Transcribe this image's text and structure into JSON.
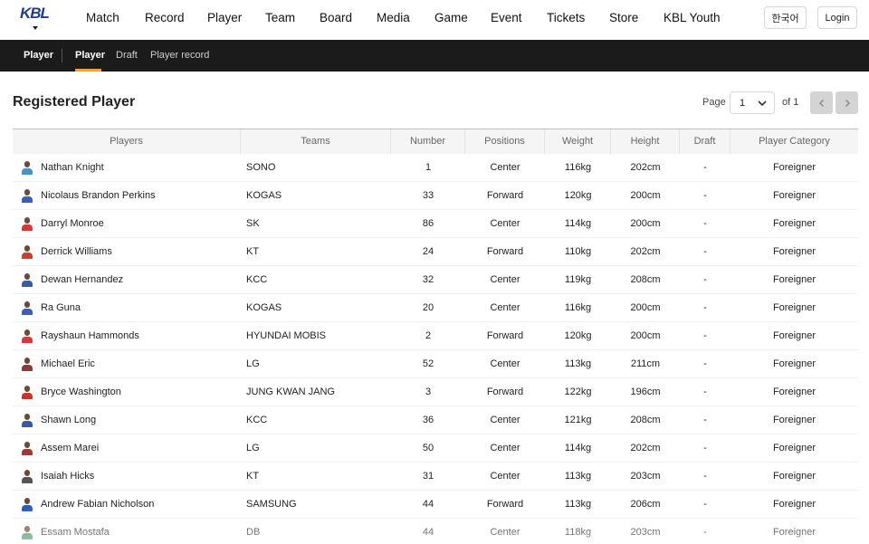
{
  "nav": {
    "logo_text": "KBL",
    "items": [
      "Match",
      "Record",
      "Player",
      "Team",
      "Board",
      "Media",
      "Game",
      "Event",
      "Tickets",
      "Store",
      "KBL Youth"
    ],
    "lang_button": "한국어",
    "login_button": "Login"
  },
  "subnav": {
    "section": "Player",
    "tabs": [
      "Player",
      "Draft",
      "Player record"
    ],
    "active_tab": "Player",
    "accent_color": "#f0a33c"
  },
  "page": {
    "title": "Registered Player",
    "page_label": "Page",
    "page_value": "1",
    "page_of": "of 1"
  },
  "table": {
    "columns": [
      "Players",
      "Teams",
      "Number",
      "Positions",
      "Weight",
      "Height",
      "Draft",
      "Player Category"
    ],
    "rows": [
      {
        "player": "Nathan Knight",
        "team": "SONO",
        "number": "1",
        "position": "Center",
        "weight": "116kg",
        "height": "202cm",
        "draft": "-",
        "category": "Foreigner",
        "jersey": "#4a90c8"
      },
      {
        "player": "Nicolaus Brandon Perkins",
        "team": "KOGAS",
        "number": "33",
        "position": "Forward",
        "weight": "120kg",
        "height": "200cm",
        "draft": "-",
        "category": "Foreigner",
        "jersey": "#3b5fb5"
      },
      {
        "player": "Darryl Monroe",
        "team": "SK",
        "number": "86",
        "position": "Center",
        "weight": "114kg",
        "height": "200cm",
        "draft": "-",
        "category": "Foreigner",
        "jersey": "#d23a3a"
      },
      {
        "player": "Derrick Williams",
        "team": "KT",
        "number": "24",
        "position": "Forward",
        "weight": "110kg",
        "height": "202cm",
        "draft": "-",
        "category": "Foreigner",
        "jersey": "#c8402f"
      },
      {
        "player": "Dewan Hernandez",
        "team": "KCC",
        "number": "32",
        "position": "Center",
        "weight": "119kg",
        "height": "208cm",
        "draft": "-",
        "category": "Foreigner",
        "jersey": "#3a5a9c"
      },
      {
        "player": "Ra Guna",
        "team": "KOGAS",
        "number": "20",
        "position": "Center",
        "weight": "116kg",
        "height": "200cm",
        "draft": "-",
        "category": "Foreigner",
        "jersey": "#3b5fb5"
      },
      {
        "player": "Rayshaun Hammonds",
        "team": "HYUNDAI MOBIS",
        "number": "2",
        "position": "Forward",
        "weight": "120kg",
        "height": "200cm",
        "draft": "-",
        "category": "Foreigner",
        "jersey": "#d33b3b"
      },
      {
        "player": "Michael Eric",
        "team": "LG",
        "number": "52",
        "position": "Center",
        "weight": "113kg",
        "height": "211cm",
        "draft": "-",
        "category": "Foreigner",
        "jersey": "#8a3b3b"
      },
      {
        "player": "Bryce Washington",
        "team": "JUNG KWAN JANG",
        "number": "3",
        "position": "Forward",
        "weight": "122kg",
        "height": "196cm",
        "draft": "-",
        "category": "Foreigner",
        "jersey": "#c0392b"
      },
      {
        "player": "Shawn Long",
        "team": "KCC",
        "number": "36",
        "position": "Center",
        "weight": "121kg",
        "height": "208cm",
        "draft": "-",
        "category": "Foreigner",
        "jersey": "#3a5a9c"
      },
      {
        "player": "Assem Marei",
        "team": "LG",
        "number": "50",
        "position": "Center",
        "weight": "114kg",
        "height": "202cm",
        "draft": "-",
        "category": "Foreigner",
        "jersey": "#9c3b3b"
      },
      {
        "player": "Isaiah Hicks",
        "team": "KT",
        "number": "31",
        "position": "Center",
        "weight": "113kg",
        "height": "203cm",
        "draft": "-",
        "category": "Foreigner",
        "jersey": "#555555"
      },
      {
        "player": "Andrew Fabian Nicholson",
        "team": "SAMSUNG",
        "number": "44",
        "position": "Forward",
        "weight": "113kg",
        "height": "206cm",
        "draft": "-",
        "category": "Foreigner",
        "jersey": "#2a5db0"
      },
      {
        "player": "Essam Mostafa",
        "team": "DB",
        "number": "44",
        "position": "Center",
        "weight": "118kg",
        "height": "203cm",
        "draft": "-",
        "category": "Foreigner",
        "jersey": "#2e8b57"
      }
    ]
  }
}
